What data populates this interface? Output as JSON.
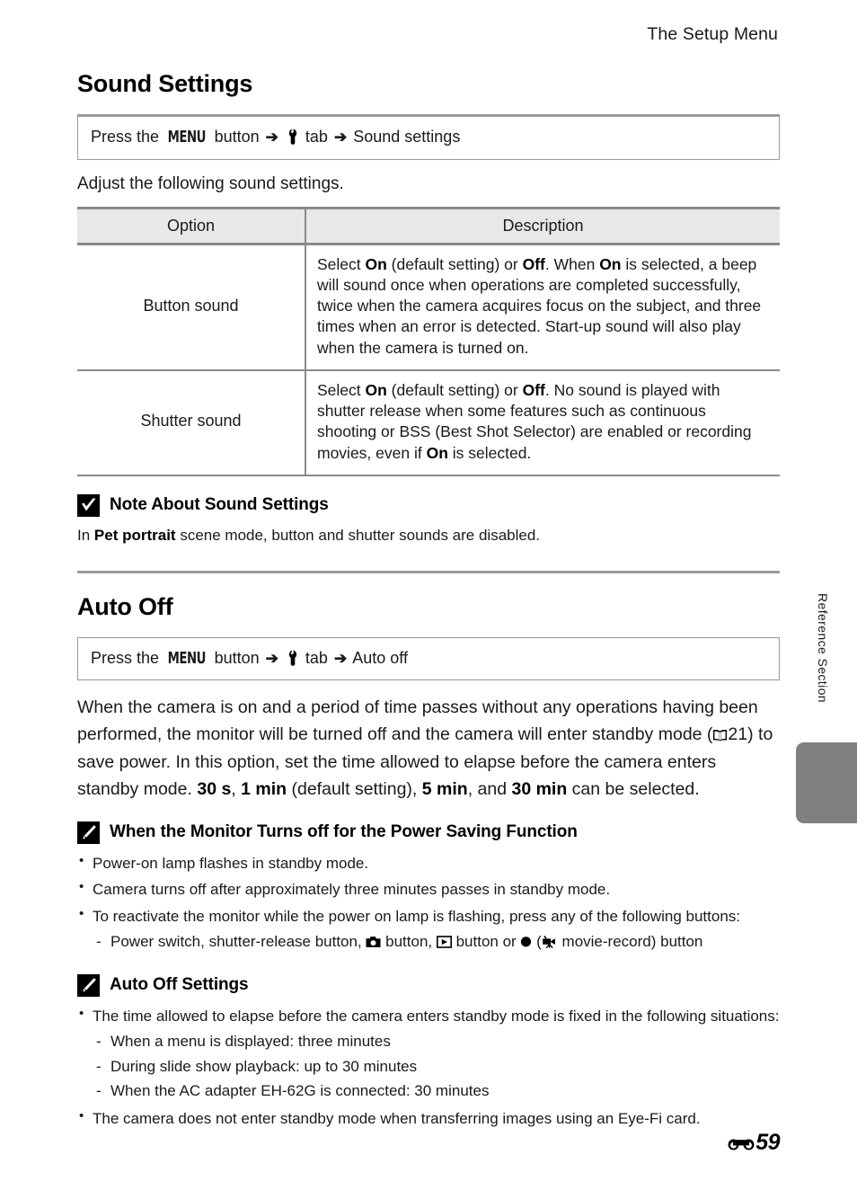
{
  "header": {
    "running_title": "The Setup Menu"
  },
  "sections": [
    {
      "id": "sound-settings",
      "title": "Sound Settings",
      "path": {
        "press_the": "Press the",
        "menu_label": "MENU",
        "button_word": "button",
        "arrow": "➔",
        "tab_icon": "wrench-icon",
        "tab_word": "tab",
        "destination": "Sound settings"
      },
      "intro": "Adjust the following sound settings.",
      "table": {
        "headers": [
          "Option",
          "Description"
        ],
        "rows": [
          {
            "option": "Button sound",
            "description_html": "Select <b>On</b> (default setting) or <b>Off</b>. When <b>On</b> is selected, a beep will sound once when operations are completed successfully, twice when the camera acquires focus on the subject, and three times when an error is detected. Start-up sound will also play when the camera is turned on."
          },
          {
            "option": "Shutter sound",
            "description_html": "Select <b>On</b> (default setting) or <b>Off</b>. No sound is played with shutter release when some features such as continuous shooting or BSS (Best Shot Selector) are enabled or recording movies, even if <b>On</b> is selected."
          }
        ]
      },
      "note": {
        "icon": "check-square-icon",
        "title": "Note About Sound Settings",
        "body_html": "In <b>Pet portrait</b> scene mode, button and shutter sounds are disabled."
      }
    },
    {
      "id": "auto-off",
      "title": "Auto Off",
      "path": {
        "press_the": "Press the",
        "menu_label": "MENU",
        "button_word": "button",
        "arrow": "➔",
        "tab_icon": "wrench-icon",
        "tab_word": "tab",
        "destination": "Auto off"
      },
      "paragraph_html": "When the camera is on and a period of time passes without any operations having been performed, the monitor will be turned off and the camera will enter standby mode (<span class=\"book-ref\"></span>21) to save power. In this option, set the time allowed to elapse before the camera enters standby mode. <b>30 s</b>, <b>1 min</b> (default setting), <b>5 min</b>, and <b>30 min</b> can be selected.",
      "paragraph_cross_ref": "21",
      "notes": [
        {
          "icon": "pencil-square-icon",
          "title": "When the Monitor Turns off for the Power Saving Function",
          "bullets": [
            {
              "text": "Power-on lamp flashes in standby mode."
            },
            {
              "text": "Camera turns off after approximately three minutes passes in standby mode."
            },
            {
              "text": "To reactivate the monitor while the power on lamp is flashing, press any of the following buttons:",
              "sub_html": "Power switch, shutter-release button, <span class=\"ic-ref-camera\"></span> button, <span class=\"ic-ref-play\"></span> button or <span class=\"ic-ref-rec\"></span> (<span class=\"ic-ref-movie\"></span> movie-record) button"
            }
          ]
        },
        {
          "icon": "pencil-square-icon",
          "title": "Auto Off Settings",
          "bullets": [
            {
              "text": "The time allowed to elapse before the camera enters standby mode is fixed in the following situations:",
              "subs": [
                "When a menu is displayed: three minutes",
                "During slide show playback: up to 30 minutes",
                "When the AC adapter EH-62G is connected: 30 minutes"
              ]
            },
            {
              "text": "The camera does not enter standby mode when transferring images using an Eye-Fi card."
            }
          ]
        }
      ]
    }
  ],
  "side": {
    "label": "Reference Section",
    "tab_color": "#808080"
  },
  "footer": {
    "marker_icon": "reference-section-glyph",
    "page_number": "59"
  },
  "colors": {
    "rule": "#9a9a9a",
    "table_header_bg": "#e8e8e8",
    "text": "#1a1a1a"
  }
}
